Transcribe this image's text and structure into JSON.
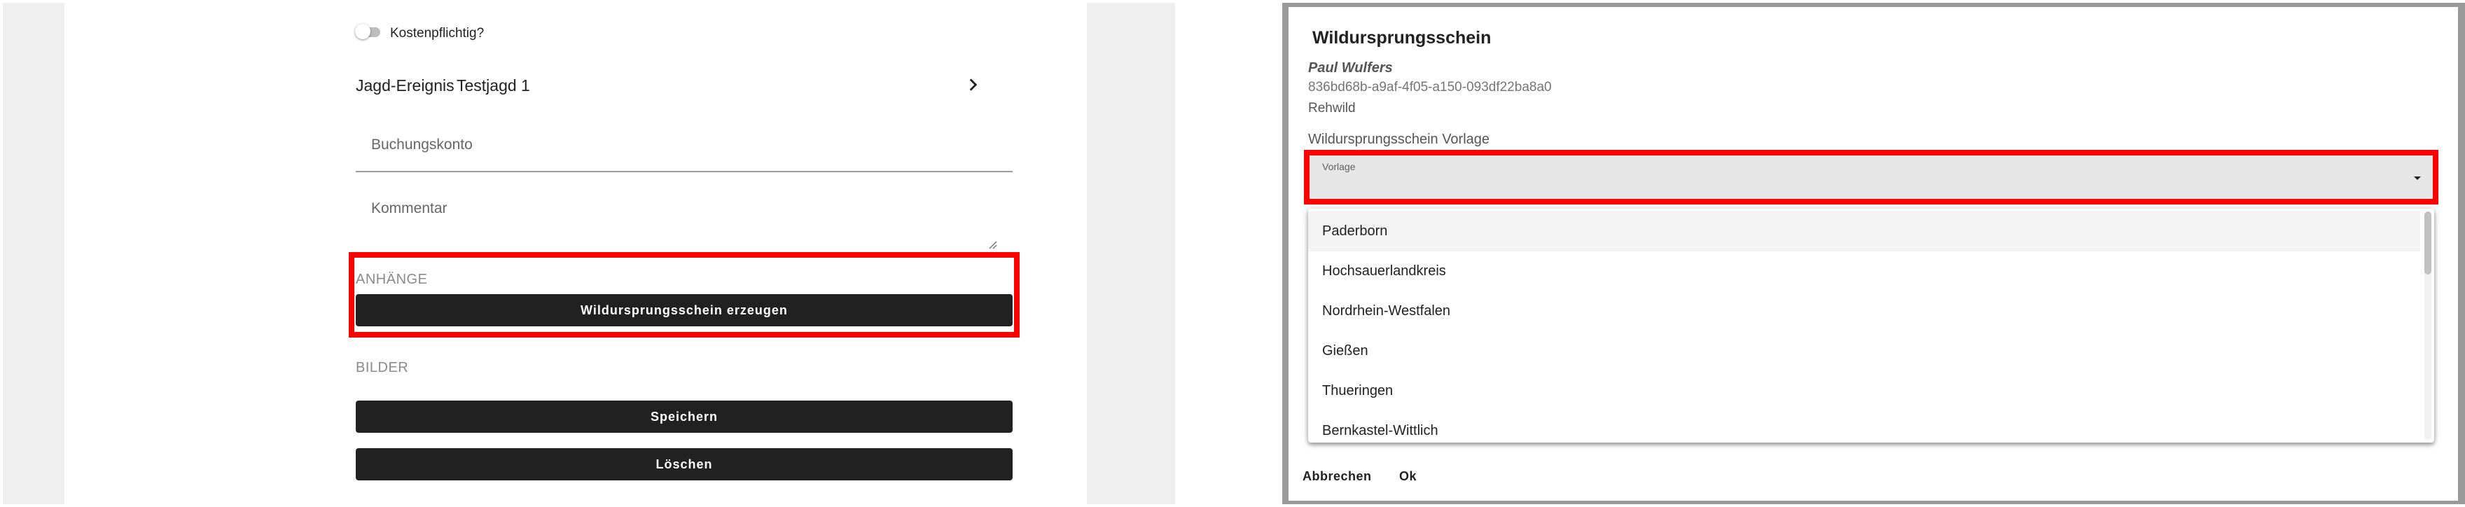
{
  "left": {
    "toggle_label": "Kostenpflichtig?",
    "event_label": "Jagd-Ereignis",
    "event_value": "Testjagd 1",
    "booking_label": "Buchungskonto",
    "comment_label": "Kommentar",
    "attachments_heading": "ANHÄNGE",
    "generate_button": "Wildursprungsschein erzeugen",
    "images_heading": "BILDER",
    "save_button": "Speichern",
    "delete_button": "Löschen"
  },
  "dialog": {
    "title": "Wildursprungsschein",
    "person": "Paul Wulfers",
    "uuid": "836bd68b-a9af-4f05-a150-093df22ba8a0",
    "game_type": "Rehwild",
    "section_label": "Wildursprungsschein Vorlage",
    "select_label": "Vorlage",
    "options": [
      "Paderborn",
      "Hochsauerlandkreis",
      "Nordrhein-Westfalen",
      "Gießen",
      "Thueringen",
      "Bernkastel-Wittlich"
    ],
    "cancel_button": "Abbrechen",
    "ok_button": "Ok"
  },
  "colors": {
    "highlight": "#ff0000",
    "button_dark": "#212121",
    "page_gray": "#efefef",
    "overlay_gray": "#9a9a9a"
  },
  "icons": [
    "chevron-right-icon",
    "chevron-down-icon",
    "resize-handle-icon"
  ]
}
